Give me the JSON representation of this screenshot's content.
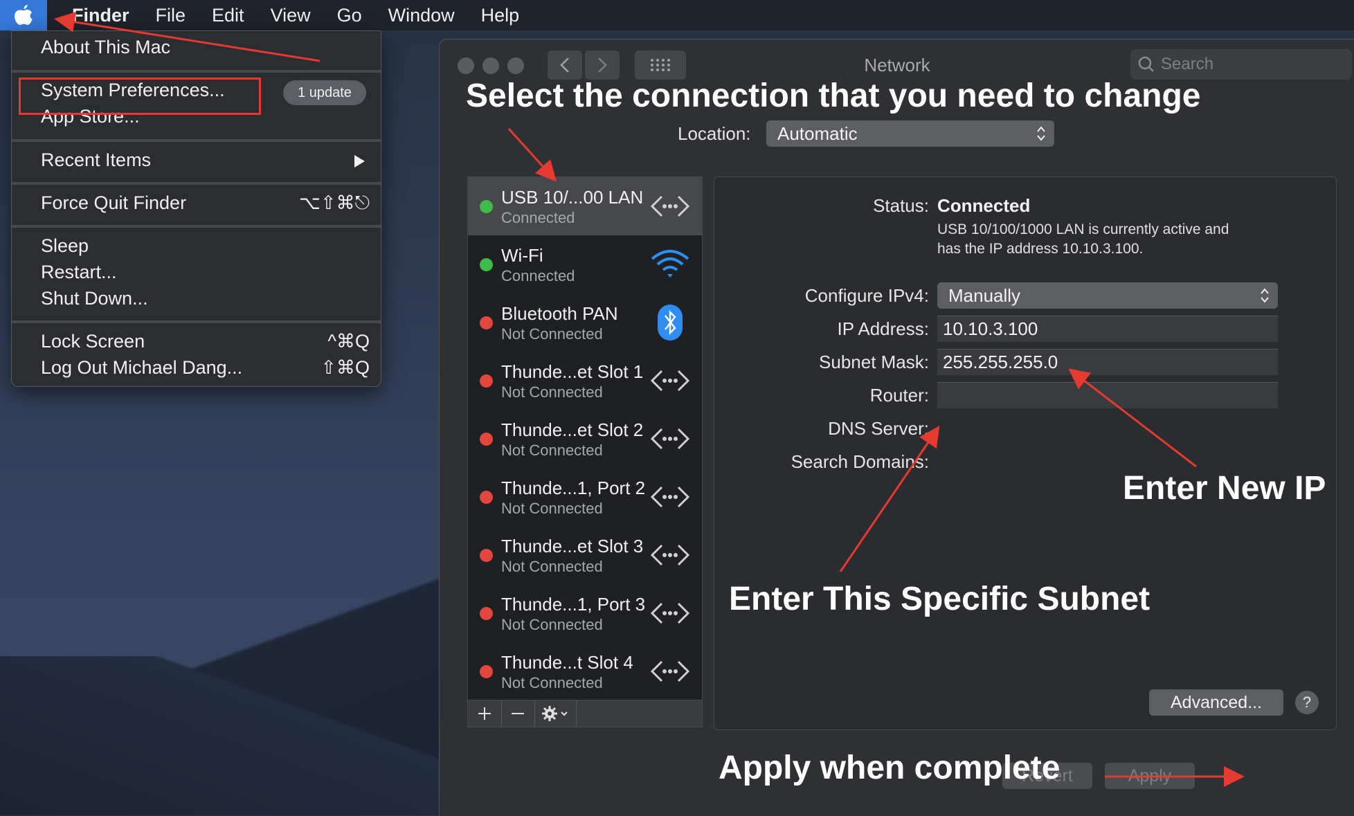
{
  "menubar": {
    "app": "Finder",
    "items": [
      "File",
      "Edit",
      "View",
      "Go",
      "Window",
      "Help"
    ]
  },
  "apple_menu": {
    "about": "About This Mac",
    "system_preferences": "System Preferences...",
    "update_badge": "1 update",
    "app_store": "App Store...",
    "recent_items": "Recent Items",
    "force_quit": "Force Quit Finder",
    "force_quit_shortcut": "⌥⇧⌘⎋",
    "sleep": "Sleep",
    "restart": "Restart...",
    "shut_down": "Shut Down...",
    "lock_screen": "Lock Screen",
    "lock_screen_shortcut": "^⌘Q",
    "log_out": "Log Out Michael Dang...",
    "log_out_shortcut": "⇧⌘Q"
  },
  "window": {
    "title": "Network",
    "search_placeholder": "Search",
    "location_label": "Location:",
    "location_value": "Automatic"
  },
  "services": [
    {
      "name": "USB 10/...00 LAN",
      "status": "Connected",
      "status_color": "#3dbc4a",
      "icon": "ethernet-icon",
      "selected": true
    },
    {
      "name": "Wi-Fi",
      "status": "Connected",
      "status_color": "#3dbc4a",
      "icon": "wifi-icon",
      "selected": false
    },
    {
      "name": "Bluetooth PAN",
      "status": "Not Connected",
      "status_color": "#e2463c",
      "icon": "bluetooth-icon",
      "selected": false
    },
    {
      "name": "Thunde...et Slot 1",
      "status": "Not Connected",
      "status_color": "#e2463c",
      "icon": "ethernet-icon",
      "selected": false
    },
    {
      "name": "Thunde...et Slot 2",
      "status": "Not Connected",
      "status_color": "#e2463c",
      "icon": "ethernet-icon",
      "selected": false
    },
    {
      "name": "Thunde...1, Port 2",
      "status": "Not Connected",
      "status_color": "#e2463c",
      "icon": "ethernet-icon",
      "selected": false
    },
    {
      "name": "Thunde...et Slot 3",
      "status": "Not Connected",
      "status_color": "#e2463c",
      "icon": "ethernet-icon",
      "selected": false
    },
    {
      "name": "Thunde...1, Port 3",
      "status": "Not Connected",
      "status_color": "#e2463c",
      "icon": "ethernet-icon",
      "selected": false
    },
    {
      "name": "Thunde...t Slot 4",
      "status": "Not Connected",
      "status_color": "#e2463c",
      "icon": "ethernet-icon",
      "selected": false
    }
  ],
  "details": {
    "status_label": "Status:",
    "status_value": "Connected",
    "status_desc_line1": "USB 10/100/1000 LAN is currently active and",
    "status_desc_line2": "has the IP address 10.10.3.100.",
    "configure_label": "Configure IPv4:",
    "configure_value": "Manually",
    "ip_label": "IP Address:",
    "ip_value": "10.10.3.100",
    "subnet_label": "Subnet Mask:",
    "subnet_value": "255.255.255.0",
    "router_label": "Router:",
    "router_value": "",
    "dns_label": "DNS Server:",
    "search_domains_label": "Search Domains:",
    "advanced_button": "Advanced...",
    "help_button": "?"
  },
  "buttons": {
    "revert": "Revert",
    "apply": "Apply"
  },
  "annotations": {
    "heading": "Select the connection that you need to change",
    "enter_ip": "Enter New IP",
    "enter_subnet": "Enter This Specific Subnet",
    "apply_note": "Apply when complete"
  },
  "colors": {
    "accent": "#3478d9",
    "annotation_red": "#e53a2f",
    "connected": "#3dbc4a",
    "not_connected": "#e2463c"
  }
}
